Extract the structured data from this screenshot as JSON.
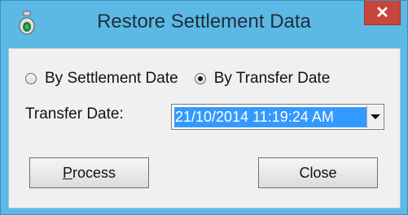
{
  "window": {
    "title": "Restore Settlement Data",
    "close_glyph": "✕"
  },
  "options": {
    "by_settlement_date": {
      "label": "By Settlement Date",
      "checked": false
    },
    "by_transfer_date": {
      "label": "By Transfer Date",
      "checked": true
    }
  },
  "transfer_date": {
    "label": "Transfer Date:",
    "value": "21/10/2014 11:19:24 AM"
  },
  "buttons": {
    "process": {
      "access_key": "P",
      "rest": "rocess"
    },
    "close": {
      "label": "Close"
    }
  },
  "colors": {
    "titlebar": "#5cb8e4",
    "close_button": "#c7463c",
    "selection": "#3399ff"
  }
}
